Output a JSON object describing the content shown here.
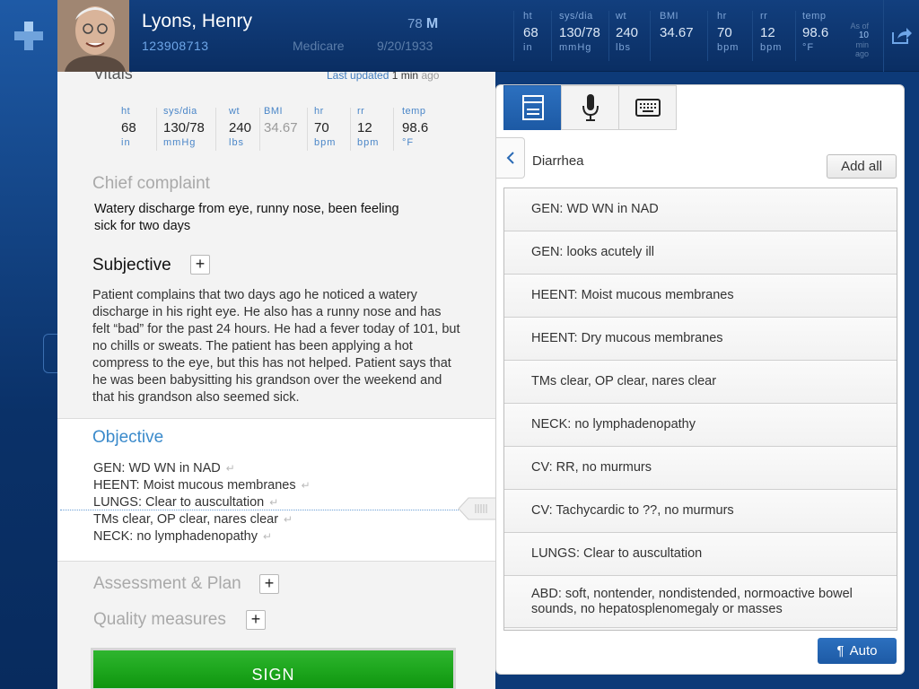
{
  "patient": {
    "name": "Lyons, Henry",
    "id": "123908713",
    "age": "78",
    "sex": "M",
    "insurance": "Medicare",
    "dob": "9/20/1933"
  },
  "header_vitals": [
    {
      "label": "ht",
      "value": "68",
      "unit": "in"
    },
    {
      "label": "sys/dia",
      "value": "130/78",
      "unit": "mmHg"
    },
    {
      "label": "wt",
      "value": "240",
      "unit": "lbs"
    },
    {
      "label": "BMI",
      "value": "34.67",
      "unit": ""
    },
    {
      "label": "hr",
      "value": "70",
      "unit": "bpm"
    },
    {
      "label": "rr",
      "value": "12",
      "unit": "bpm"
    },
    {
      "label": "temp",
      "value": "98.6",
      "unit": "°F"
    }
  ],
  "asof": {
    "prefix": "As of",
    "number": "10",
    "unit": "min",
    "suffix": "ago"
  },
  "note": {
    "vitals_title": "Vitals",
    "updated_prefix": "Last updated",
    "updated_value": "1 min",
    "updated_suffix": "ago",
    "vitals": [
      {
        "label": "ht",
        "value": "68",
        "unit": "in"
      },
      {
        "label": "sys/dia",
        "value": "130/78",
        "unit": "mmHg"
      },
      {
        "label": "wt",
        "value": "240",
        "unit": "lbs"
      },
      {
        "label": "BMI",
        "value": "34.67",
        "unit": ""
      },
      {
        "label": "hr",
        "value": "70",
        "unit": "bpm"
      },
      {
        "label": "rr",
        "value": "12",
        "unit": "bpm"
      },
      {
        "label": "temp",
        "value": "98.6",
        "unit": "°F"
      }
    ],
    "chief_complaint_title": "Chief complaint",
    "chief_complaint_text": "Watery discharge from eye, runny nose, been feeling sick for two days",
    "subjective_title": "Subjective",
    "subjective_text": "Patient complains that two days ago he noticed a watery discharge in his right eye. He also has a runny nose and has felt “bad” for the past 24 hours. He had a fever today of 101, but no chills or sweats. The patient has been applying a hot compress to the eye, but this has not helped. Patient says that he was been babysitting his grandson over the weekend and that his grandson also seemed sick.",
    "objective_title": "Objective",
    "objective_lines": [
      "GEN:  WD WN in NAD",
      "HEENT:  Moist mucous membranes",
      "LUNGS: Clear to auscultation",
      "TMs clear, OP clear, nares clear",
      "NECK:  no lymphadenopathy"
    ],
    "return_glyph": "↵",
    "plus_glyph": "+",
    "assessment_title": "Assessment & Plan",
    "quality_title": "Quality measures",
    "sign_label": "SIGN"
  },
  "picker": {
    "breadcrumb": "Diarrhea",
    "add_all_label": "Add all",
    "items": [
      "GEN:  WD WN in NAD",
      "GEN:  looks acutely ill",
      "HEENT:  Moist mucous membranes",
      "HEENT:  Dry mucous membranes",
      "TMs clear, OP clear, nares clear",
      "NECK:  no lymphadenopathy",
      "CV:  RR, no murmurs",
      "CV:  Tachycardic to ??, no murmurs",
      "LUNGS:  Clear to auscultation",
      "ABD:  soft, nontender, nondistended, normoactive bowel sounds, no hepatosplenomegaly or masses"
    ],
    "auto_glyph": "¶",
    "auto_label": "Auto",
    "modes": [
      "template-icon",
      "microphone-icon",
      "keyboard-icon"
    ]
  },
  "colors": {
    "header_bg": "#0a2e63",
    "accent_blue": "#3a8acb",
    "sign_green": "#1ea71e"
  }
}
